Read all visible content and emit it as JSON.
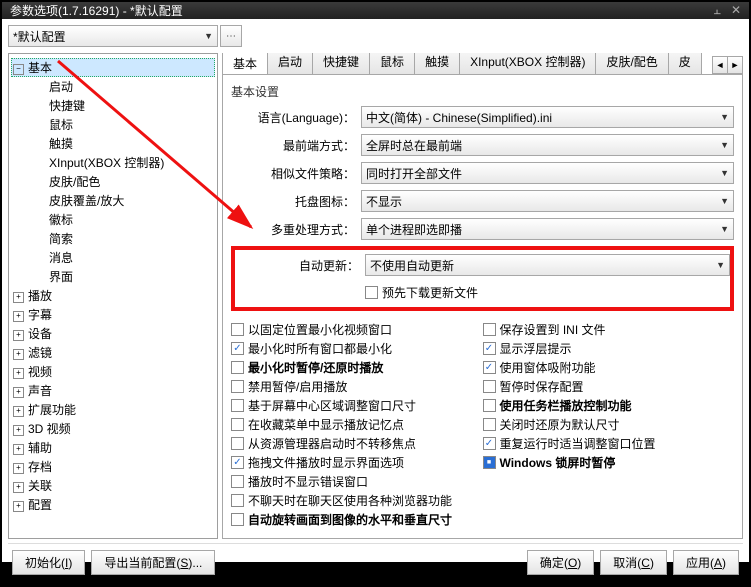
{
  "title": "参数选项(1.7.16291) - *默认配置",
  "config_combo": "*默认配置",
  "tree": {
    "root": "基本",
    "children": [
      "启动",
      "快捷键",
      "鼠标",
      "触摸",
      "XInput(XBOX 控制器)",
      "皮肤/配色",
      "皮肤覆盖/放大",
      "徽标",
      "简索",
      "消息",
      "界面"
    ],
    "siblings": [
      "播放",
      "字幕",
      "设备",
      "滤镜",
      "视频",
      "声音",
      "扩展功能",
      "3D 视频",
      "辅助",
      "存档",
      "关联",
      "配置"
    ]
  },
  "tabs": [
    "基本",
    "启动",
    "快捷键",
    "鼠标",
    "触摸",
    "XInput(XBOX 控制器)",
    "皮肤/配色",
    "皮"
  ],
  "group_title": "基本设置",
  "rows": {
    "language_label": "语言(Language)：",
    "language_value": "中文(简体) - Chinese(Simplified).ini",
    "foreground_label": "最前端方式：",
    "foreground_value": "全屏时总在最前端",
    "similar_label": "相似文件策略：",
    "similar_value": "同时打开全部文件",
    "tray_label": "托盘图标：",
    "tray_value": "不显示",
    "multi_label": "多重处理方式：",
    "multi_value": "单个进程即选即播",
    "auto_label": "自动更新：",
    "auto_value": "不使用自动更新",
    "auto_cb": "预先下载更新文件"
  },
  "checks_left": [
    {
      "label": "以固定位置最小化视频窗口",
      "checked": false,
      "bold": false
    },
    {
      "label": "最小化时所有窗口都最小化",
      "checked": true,
      "bold": false
    },
    {
      "label": "最小化时暂停/还原时播放",
      "checked": false,
      "bold": true
    },
    {
      "label": "禁用暂停/启用播放",
      "checked": false,
      "bold": false
    },
    {
      "label": "基于屏幕中心区域调整窗口尺寸",
      "checked": false,
      "bold": false
    },
    {
      "label": "在收藏菜单中显示播放记忆点",
      "checked": false,
      "bold": false
    },
    {
      "label": "从资源管理器启动时不转移焦点",
      "checked": false,
      "bold": false
    },
    {
      "label": "拖拽文件播放时显示界面选项",
      "checked": true,
      "bold": false
    },
    {
      "label": "播放时不显示错误窗口",
      "checked": false,
      "bold": false
    },
    {
      "label": "不聊天时在聊天区使用各种浏览器功能",
      "checked": false,
      "bold": false
    },
    {
      "label": "自动旋转画面到图像的水平和垂直尺寸",
      "checked": false,
      "bold": true
    }
  ],
  "checks_right": [
    {
      "label": "保存设置到 INI 文件",
      "checked": false,
      "bold": false
    },
    {
      "label": "显示浮层提示",
      "checked": true,
      "bold": false
    },
    {
      "label": "使用窗体吸附功能",
      "checked": true,
      "bold": false
    },
    {
      "label": "暂停时保存配置",
      "checked": false,
      "bold": false
    },
    {
      "label": "使用任务栏播放控制功能",
      "checked": false,
      "bold": true
    },
    {
      "label": "关闭时还原为默认尺寸",
      "checked": false,
      "bold": false
    },
    {
      "label": "重复运行时适当调整窗口位置",
      "checked": true,
      "bold": false
    },
    {
      "label": "Windows 锁屏时暂停",
      "checked": true,
      "bold": true,
      "blue": true
    }
  ],
  "footer": {
    "init": "初始化",
    "init_key": "I",
    "export": "导出当前配置",
    "export_key": "S",
    "ok": "确定",
    "ok_key": "O",
    "cancel": "取消",
    "cancel_key": "C",
    "apply": "应用",
    "apply_key": "A"
  }
}
